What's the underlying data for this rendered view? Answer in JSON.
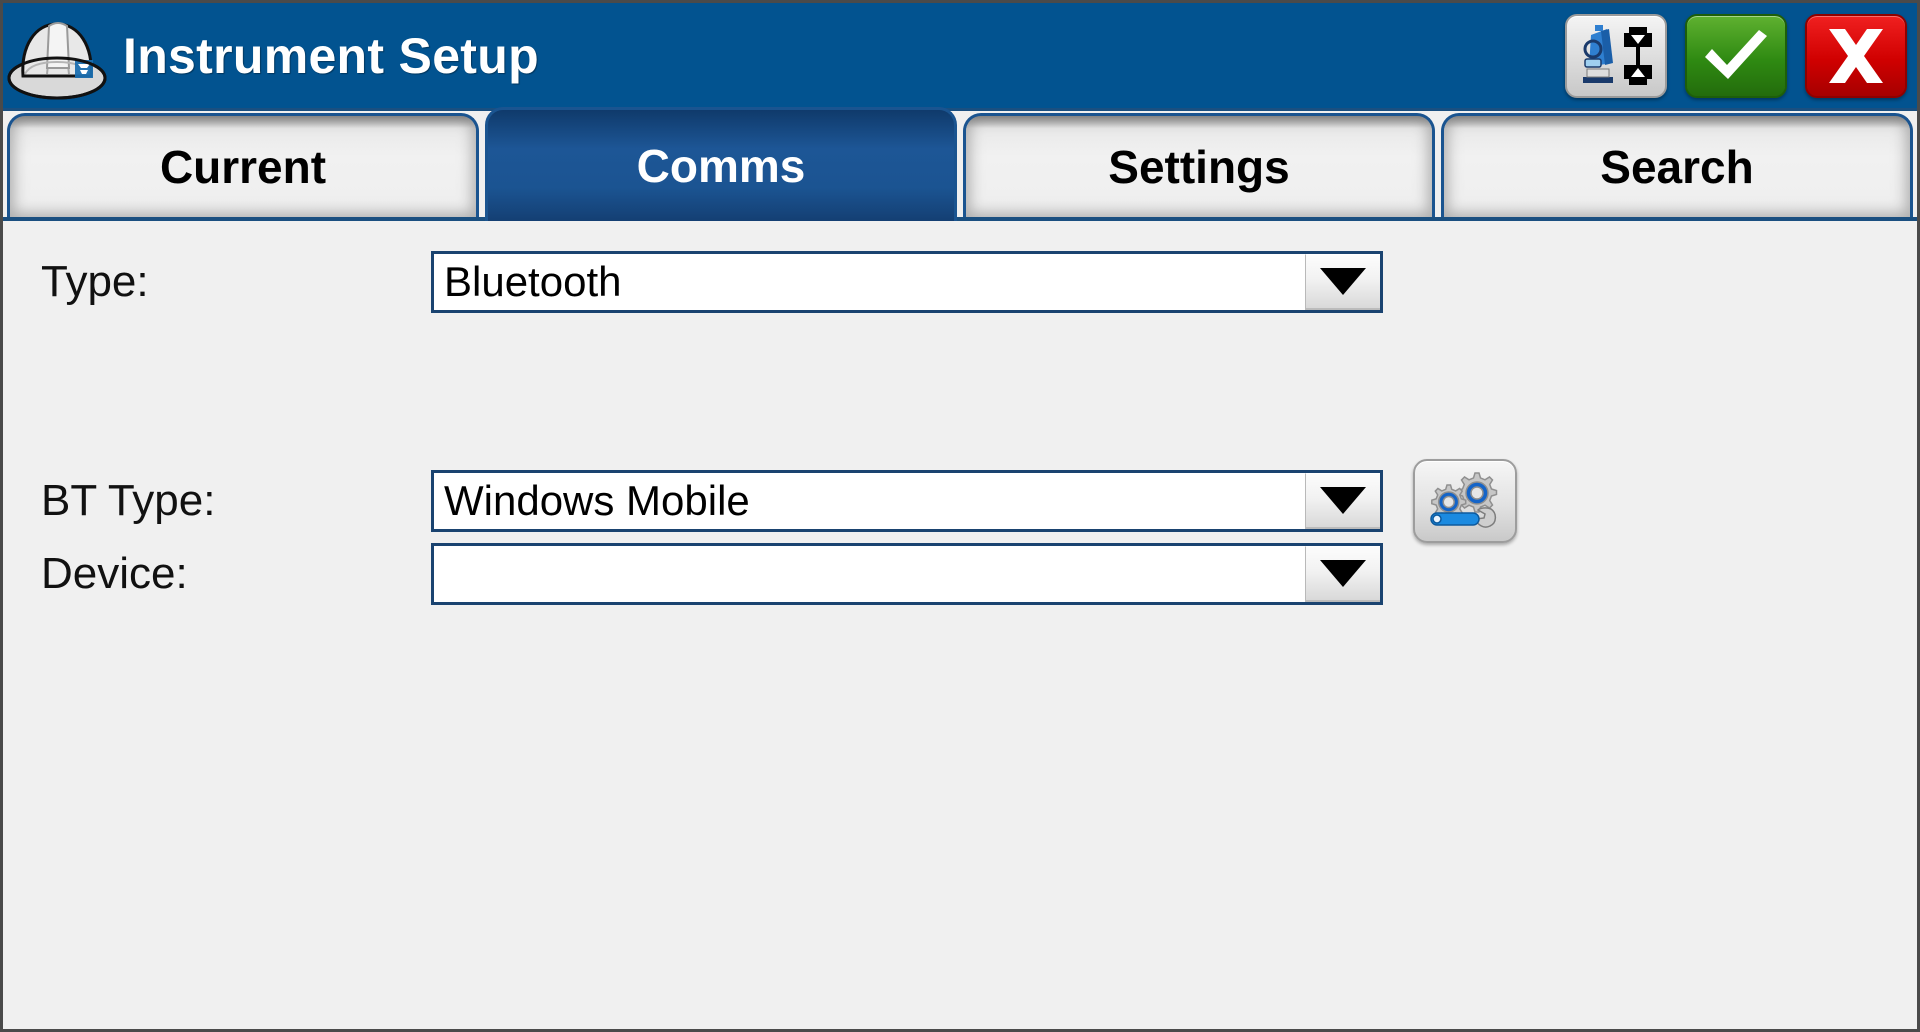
{
  "window": {
    "title": "Instrument Setup",
    "logo_icon": "hard-hat-icon",
    "background_color": "#f0f0f0",
    "titlebar_color": "#025390"
  },
  "titlebar_actions": [
    {
      "name": "connect-instrument-button",
      "icon": "total-station-connect-icon",
      "label": ""
    },
    {
      "name": "accept-button",
      "icon": "checkmark-icon",
      "label": "",
      "color": "#2f8a12"
    },
    {
      "name": "cancel-button",
      "icon": "close-x-icon",
      "label": "",
      "color": "#d00000"
    }
  ],
  "tabs": [
    {
      "label": "Current",
      "active": false
    },
    {
      "label": "Comms",
      "active": true
    },
    {
      "label": "Settings",
      "active": false
    },
    {
      "label": "Search",
      "active": false
    }
  ],
  "form": {
    "type": {
      "label": "Type:",
      "value": "Bluetooth",
      "placeholder": "",
      "dropdown_icon": "chevron-down-icon"
    },
    "bt_type": {
      "label": "BT Type:",
      "value": "Windows Mobile",
      "placeholder": "",
      "dropdown_icon": "chevron-down-icon",
      "config_icon": "gears-wrench-settings-icon"
    },
    "device": {
      "label": "Device:",
      "value": "",
      "placeholder": "",
      "dropdown_icon": "chevron-down-icon"
    }
  }
}
